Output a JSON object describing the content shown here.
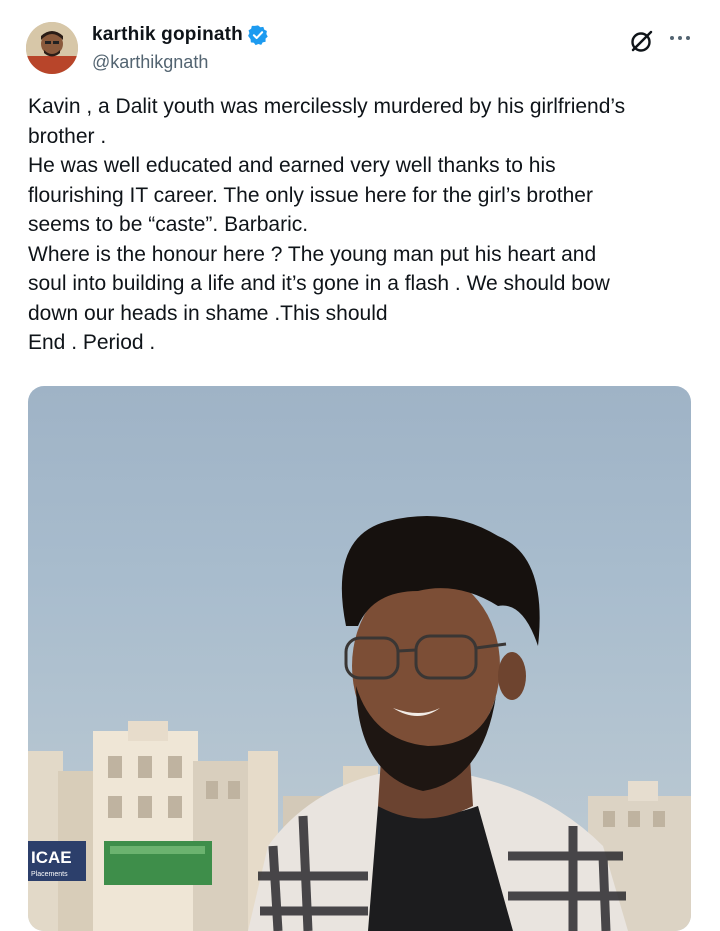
{
  "author": {
    "display_name": "karthik gopinath",
    "handle": "@karthikgnath",
    "verified": true
  },
  "icons": {
    "grok": "grok-icon",
    "more": "more-options-icon",
    "verified": "verified-badge-icon"
  },
  "tweet": {
    "lines": [
      "Kavin , a Dalit youth was mercilessly murdered by his girlfriend’s",
      "brother .",
      "He was well educated and earned very well thanks to his",
      "flourishing IT career. The only issue here for the girl’s brother",
      "seems to be “caste”. Barbaric.",
      "Where is the honour here ? The young man put his heart and",
      "soul into building a life and it’s gone in a flash . We should bow",
      "down our heads in shame .This should",
      "End . Period ."
    ]
  },
  "media": {
    "signs": [
      "ICAE",
      "Placements"
    ]
  },
  "colors": {
    "text": "#0f1419",
    "secondary": "#536471",
    "verified": "#1d9bf0"
  }
}
